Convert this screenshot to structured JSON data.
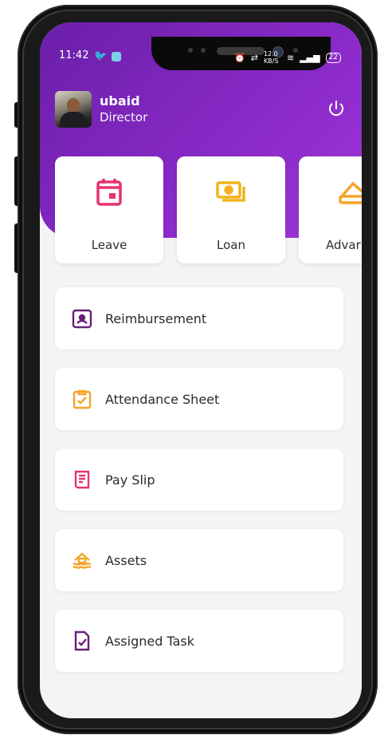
{
  "status_bar": {
    "time": "11:42",
    "net_speed": "12.0 KB/S",
    "battery": "22"
  },
  "profile": {
    "name": "ubaid",
    "role": "Director"
  },
  "quick_cards": [
    {
      "label": "Leave",
      "icon": "calendar-icon",
      "color": "#e8336d"
    },
    {
      "label": "Loan",
      "icon": "cash-icon",
      "color": "#f0b41c"
    },
    {
      "label": "Advar",
      "icon": "advance-icon",
      "color": "#f5a42a"
    }
  ],
  "menu": [
    {
      "label": "Reimbursement",
      "icon": "reimbursement-icon",
      "color": "#6a1f7a"
    },
    {
      "label": "Attendance Sheet",
      "icon": "clipboard-check-icon",
      "color": "#f5a42a"
    },
    {
      "label": "Pay Slip",
      "icon": "receipt-icon",
      "color": "#e8336d"
    },
    {
      "label": "Assets",
      "icon": "assets-icon",
      "color": "#f5a42a"
    },
    {
      "label": "Assigned Task",
      "icon": "task-check-icon",
      "color": "#6a1f7a"
    }
  ],
  "colors": {
    "header_start": "#6a1fa8",
    "header_end": "#9d37d6"
  }
}
